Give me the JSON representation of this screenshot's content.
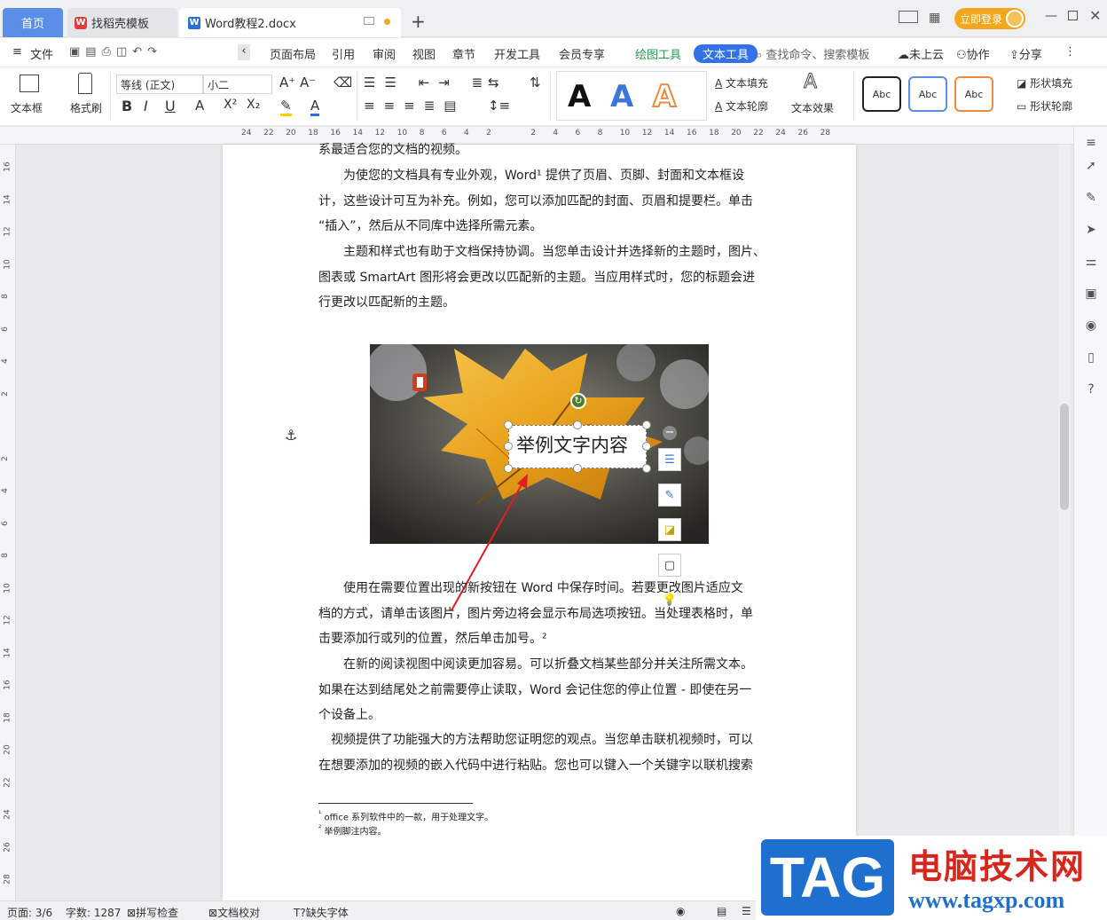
{
  "titlebar": {
    "tabs": [
      {
        "label": "首页"
      },
      {
        "label": "找稻壳模板"
      },
      {
        "label": "Word教程2.docx"
      }
    ],
    "new_tab": "+",
    "login_label": "立即登录"
  },
  "menubar": {
    "file": "文件",
    "items": [
      "页面布局",
      "引用",
      "审阅",
      "视图",
      "章节",
      "开发工具",
      "会员专享"
    ],
    "drawing_tools": "绘图工具",
    "text_tools": "文本工具",
    "search_placeholder": "查找命令、搜索模板",
    "cloud": "未上云",
    "collab": "协作",
    "share": "分享"
  },
  "ribbon": {
    "textbox": "文本框",
    "format_brush": "格式刷",
    "font_name": "等线 (正文)",
    "font_size": "小二",
    "text_fill": "文本填充",
    "text_outline": "文本轮廓",
    "text_effect": "文本效果",
    "shape_fill": "形状填充",
    "shape_outline": "形状轮廓",
    "style_sample": "Abc",
    "big_a": "A"
  },
  "ruler": {
    "numbers": [
      "24",
      "22",
      "20",
      "18",
      "16",
      "14",
      "12",
      "10",
      "8",
      "6",
      "4",
      "2",
      "",
      "2",
      "4",
      "6",
      "8",
      "10",
      "12",
      "14",
      "16",
      "18",
      "20",
      "22",
      "24",
      "26",
      "28"
    ],
    "vnumbers": [
      "16",
      "14",
      "12",
      "10",
      "8",
      "6",
      "4",
      "2",
      "",
      "2",
      "4",
      "6",
      "8",
      "10",
      "12",
      "14",
      "16",
      "18",
      "20",
      "22",
      "24",
      "26",
      "28"
    ]
  },
  "document": {
    "top_partial": "系最适合您的文档的视频。",
    "para1": [
      "为使您的文档具有专业外观，Word¹ 提供了页眉、页脚、封面和文本框设",
      "计，这些设计可互为补充。例如，您可以添加匹配的封面、页眉和提要栏。单击",
      "“插入”，然后从不同库中选择所需元素。"
    ],
    "para2": [
      "主题和样式也有助于文档保持协调。当您单击设计并选择新的主题时，图片、",
      "图表或 SmartArt 图形将会更改以匹配新的主题。当应用样式时，您的标题会进",
      "行更改以匹配新的主题。"
    ],
    "textbox_content": "举例文字内容",
    "para3": [
      "使用在需要位置出现的新按钮在 Word 中保存时间。若要更改图片适应文",
      "档的方式，请单击该图片，图片旁边将会显示布局选项按钮。当处理表格时，单",
      "击要添加行或列的位置，然后单击加号。²"
    ],
    "para4": [
      "在新的阅读视图中阅读更加容易。可以折叠文档某些部分并关注所需文本。",
      "如果在达到结尾处之前需要停止读取，Word 会记住您的停止位置 - 即使在另一",
      "个设备上。"
    ],
    "para5": [
      "视频提供了功能强大的方法帮助您证明您的观点。当您单击联机视频时，可以",
      "在想要添加的视频的嵌入代码中进行粘贴。您也可以键入一个关键字以联机搜索"
    ],
    "footnote1": "office 系列软件中的一款，用于处理文字。",
    "footnote2": "举例脚注内容。",
    "footnote_mark1": "¹",
    "footnote_mark2": "²"
  },
  "statusbar": {
    "page": "页面: 3/6",
    "words": "字数: 1287",
    "spell": "拼写检查",
    "proof": "文档校对",
    "missing_font": "缺失字体"
  },
  "watermark": {
    "tag": "TAG",
    "site_name": "电脑技术网",
    "url": "www.tagxp.com"
  },
  "colors": {
    "accent": "#3372e6",
    "home_tab": "#5b8ee6",
    "login": "#f2a71c",
    "green": "#2a9a55",
    "arrow": "#e02020"
  }
}
